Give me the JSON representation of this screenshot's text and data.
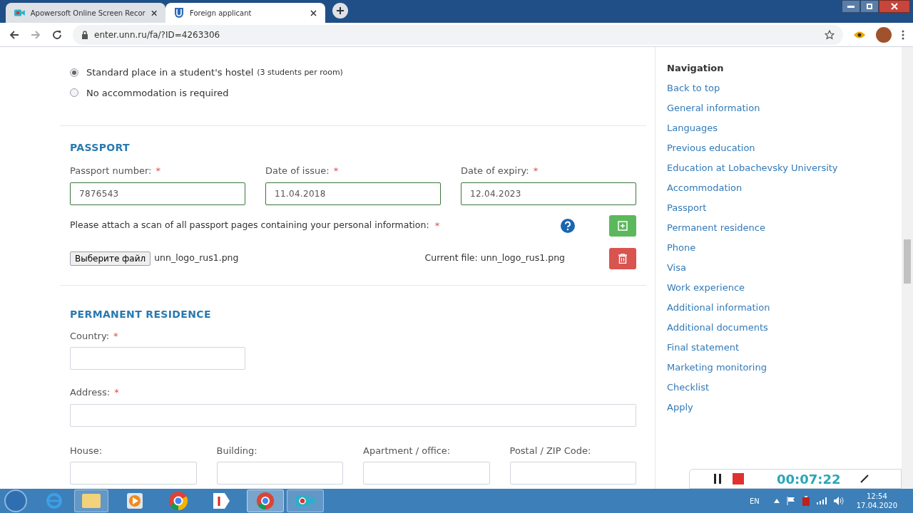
{
  "browser": {
    "tabs": [
      {
        "title": "Apowersoft Online Screen Recor",
        "selected": false
      },
      {
        "title": "Foreign applicant",
        "selected": true
      }
    ],
    "address": "enter.unn.ru/fa/?ID=4263306"
  },
  "accommodation": {
    "options": [
      {
        "label": "Standard place in a student's hostel",
        "note": "(3 students per room)",
        "selected": true
      },
      {
        "label": "No accommodation is required",
        "selected": false
      }
    ]
  },
  "passport": {
    "heading": "PASSPORT",
    "fields": [
      {
        "label": "Passport number:",
        "required_mark": "*",
        "value": "7876543",
        "valid": true
      },
      {
        "label": "Date of issue:",
        "required_mark": "*",
        "value": "11.04.2018",
        "valid": true
      },
      {
        "label": "Date of expiry:",
        "required_mark": "*",
        "value": "12.04.2023",
        "valid": true
      }
    ],
    "attach_label": "Please attach a scan of all passport pages containing your personal information:",
    "attach_required_mark": "*",
    "file_button": "Выберите файл",
    "file_name": "unn_logo_rus1.png",
    "current_file": "Current file: unn_logo_rus1.png"
  },
  "permanent_residence": {
    "heading": "PERMANENT RESIDENCE",
    "rows": [
      [
        {
          "label": "Country:",
          "required_mark": "*",
          "valid": false
        }
      ],
      [
        {
          "label": "Address:",
          "required_mark": "*",
          "valid": false
        }
      ],
      [
        {
          "label": "House:",
          "valid": false
        },
        {
          "label": "Building:",
          "valid": false
        },
        {
          "label": "Apartment / office:",
          "valid": false
        },
        {
          "label": "Postal / ZIP Code:",
          "valid": false
        }
      ]
    ]
  },
  "navigation": {
    "title": "Navigation",
    "items": [
      "Back to top",
      "General information",
      "Languages",
      "Previous education",
      "Education at Lobachevsky University",
      "Accommodation",
      "Passport",
      "Permanent residence",
      "Phone",
      "Visa",
      "Work experience",
      "Additional information",
      "Additional documents",
      "Final statement",
      "Marketing monitoring",
      "Checklist",
      "Apply"
    ]
  },
  "recorder": {
    "timer": "00:07:22"
  },
  "taskbar": {
    "language": "EN",
    "time": "12:54",
    "date": "17.04.2020"
  }
}
